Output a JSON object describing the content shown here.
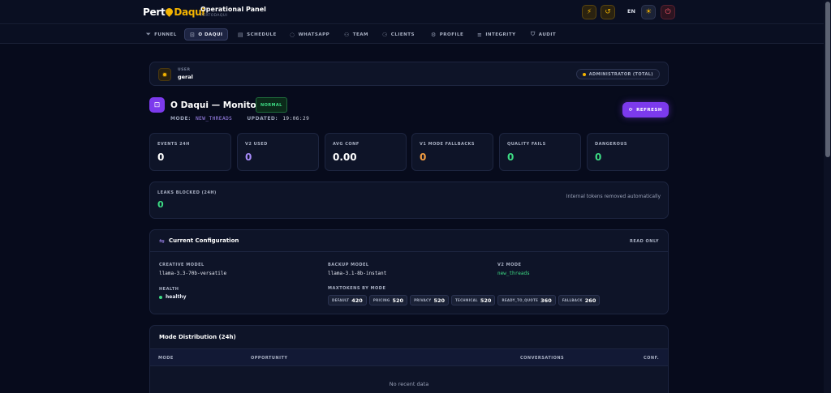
{
  "brand": {
    "logo_part1": "Pert",
    "logo_part2": "Daqui",
    "title": "Operational Panel",
    "subtitle": "PERTODAQUI"
  },
  "topbar": {
    "language": "EN"
  },
  "nav": {
    "items": [
      {
        "label": "FUNNEL",
        "icon": "funnel-icon",
        "active": false
      },
      {
        "label": "O DAQUI",
        "icon": "robot-icon",
        "active": true
      },
      {
        "label": "SCHEDULE",
        "icon": "calendar-icon",
        "active": false
      },
      {
        "label": "WHATSAPP",
        "icon": "whatsapp-icon",
        "active": false
      },
      {
        "label": "TEAM",
        "icon": "team-icon",
        "active": false
      },
      {
        "label": "CLIENTS",
        "icon": "clients-icon",
        "active": false
      },
      {
        "label": "PROFILE",
        "icon": "gear-icon",
        "active": false
      },
      {
        "label": "INTEGRITY",
        "icon": "list-icon",
        "active": false
      },
      {
        "label": "AUDIT",
        "icon": "shield-icon",
        "active": false
      }
    ]
  },
  "user": {
    "label": "USER",
    "name": "geral",
    "role_badge": "ADMINISTRATOR (TOTAL)"
  },
  "header": {
    "title": "O Daqui — Monitor",
    "status_badge": "NORMAL",
    "mode_label": "MODE:",
    "mode_value": "NEW_THREADS",
    "updated_label": "UPDATED:",
    "updated_value": "19:06:29",
    "refresh_label": "REFRESH"
  },
  "stats": [
    {
      "label": "EVENTS 24H",
      "value": "0",
      "color": "#ffffff"
    },
    {
      "label": "V2 USED",
      "value": "0",
      "color": "#a78bfa"
    },
    {
      "label": "AVG CONF",
      "value": "0.00",
      "color": "#ffffff"
    },
    {
      "label": "V1 MODE FALLBACKS",
      "value": "0",
      "color": "#f59e42"
    },
    {
      "label": "QUALITY FAILS",
      "value": "0",
      "color": "#3ddc84"
    },
    {
      "label": "DANGEROUS",
      "value": "0",
      "color": "#3ddc84"
    }
  ],
  "leaks": {
    "label": "LEAKS BLOCKED (24H)",
    "value": "0",
    "note": "Internal tokens removed automatically"
  },
  "config": {
    "title": "Current Configuration",
    "readonly_label": "READ ONLY",
    "creative_model_label": "CREATIVE MODEL",
    "creative_model_value": "llama-3.3-70b-versatile",
    "backup_model_label": "BACKUP MODEL",
    "backup_model_value": "llama-3.1-8b-instant",
    "v2_mode_label": "V2 MODE",
    "v2_mode_value": "new_threads",
    "health_label": "HEALTH",
    "health_value": "healthy",
    "maxtokens_label": "MAXTOKENS BY MODE",
    "tokens": [
      {
        "key": "DEFAULT",
        "value": "420"
      },
      {
        "key": "PRICING",
        "value": "520"
      },
      {
        "key": "PRIVACY",
        "value": "520"
      },
      {
        "key": "TECHNICAL",
        "value": "520"
      },
      {
        "key": "READY_TO_QUOTE",
        "value": "360"
      },
      {
        "key": "FALLBACK",
        "value": "260"
      }
    ]
  },
  "distribution": {
    "title": "Mode Distribution (24h)",
    "columns": [
      "MODE",
      "OPPORTUNITY",
      "CONVERSATIONS",
      "CONF."
    ],
    "empty_text": "No recent data"
  },
  "colors": {
    "accent": "#7c3aed",
    "brand": "#f5b400",
    "success": "#3ddc84",
    "warning": "#f59e42",
    "background": "#070b1c"
  }
}
